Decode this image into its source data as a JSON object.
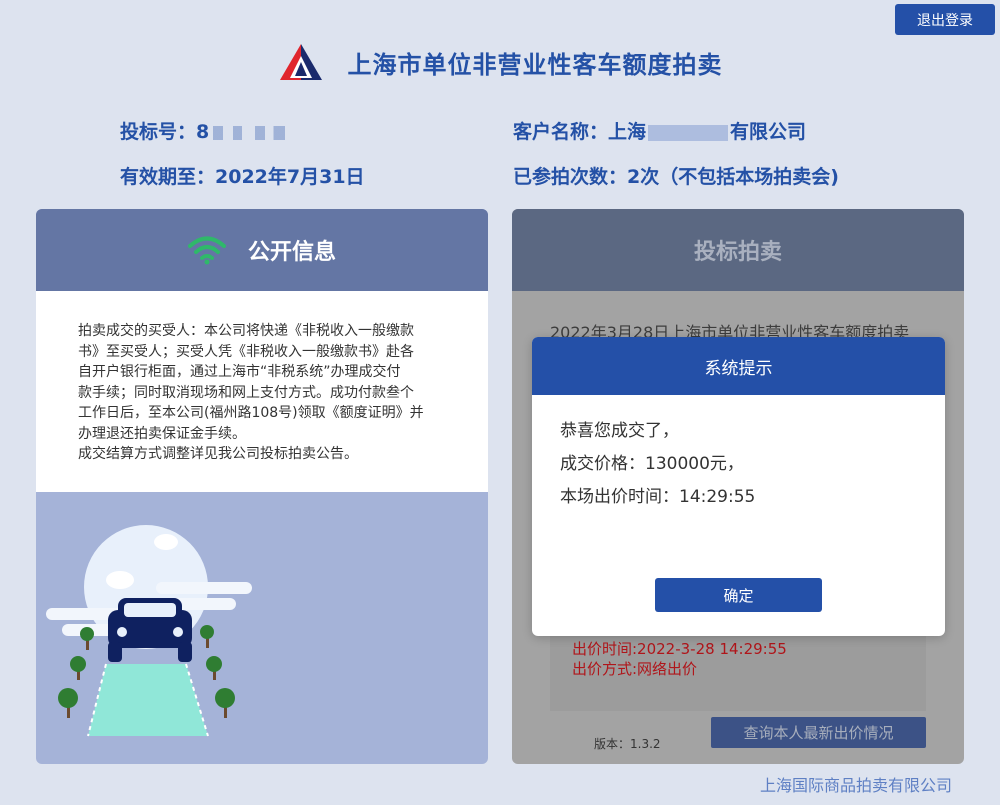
{
  "topbar": {
    "logout_label": "退出登录"
  },
  "header": {
    "title": "上海市单位非营业性客车额度拍卖"
  },
  "account": {
    "bid_no_label": "投标号：",
    "bid_no_value": "8",
    "customer_label": "客户名称：",
    "customer_value": "上海",
    "customer_suffix": "有限公司",
    "valid_label": "有效期至：",
    "valid_value": "2022年7月31日",
    "count_label": "已参拍次数：",
    "count_value": "2次（不包括本场拍卖会)"
  },
  "public_info": {
    "title": "公开信息",
    "icon": "wifi-icon",
    "notice_lines": [
      "拍卖成交的买受人：本公司将快递《非税收入一般缴款",
      "书》至买受人；买受人凭《非税收入一般缴款书》赴各",
      "自开户银行柜面，通过上海市“非税系统”办理成交付",
      "款手续；同时取消现场和网上支付方式。成功付款叁个",
      "工作日后，至本公司(福州路108号)领取《额度证明》并",
      "办理退还拍卖保证金手续。",
      "成交结算方式调整详见我公司投标拍卖公告。"
    ]
  },
  "bidding": {
    "title": "投标拍卖",
    "auction_title": "2022年3月28日上海市单位非营业性客车额度拍卖",
    "bid_time": "出价时间:2022-3-28 14:29:55",
    "bid_method": "出价方式:网络出价",
    "version": "版本：1.3.2",
    "query_label": "查询本人最新出价情况"
  },
  "modal": {
    "title": "系统提示",
    "line1": "恭喜您成交了，",
    "line2": "成交价格：130000元，",
    "line3": "本场出价时间：14:29:55",
    "confirm_label": "确定"
  },
  "footer": {
    "company": "上海国际商品拍卖有限公司"
  },
  "colors": {
    "accent": "#2450a8",
    "title": "#2451a6",
    "wifi": "#2fb86a",
    "bid_text": "#b0151a"
  }
}
